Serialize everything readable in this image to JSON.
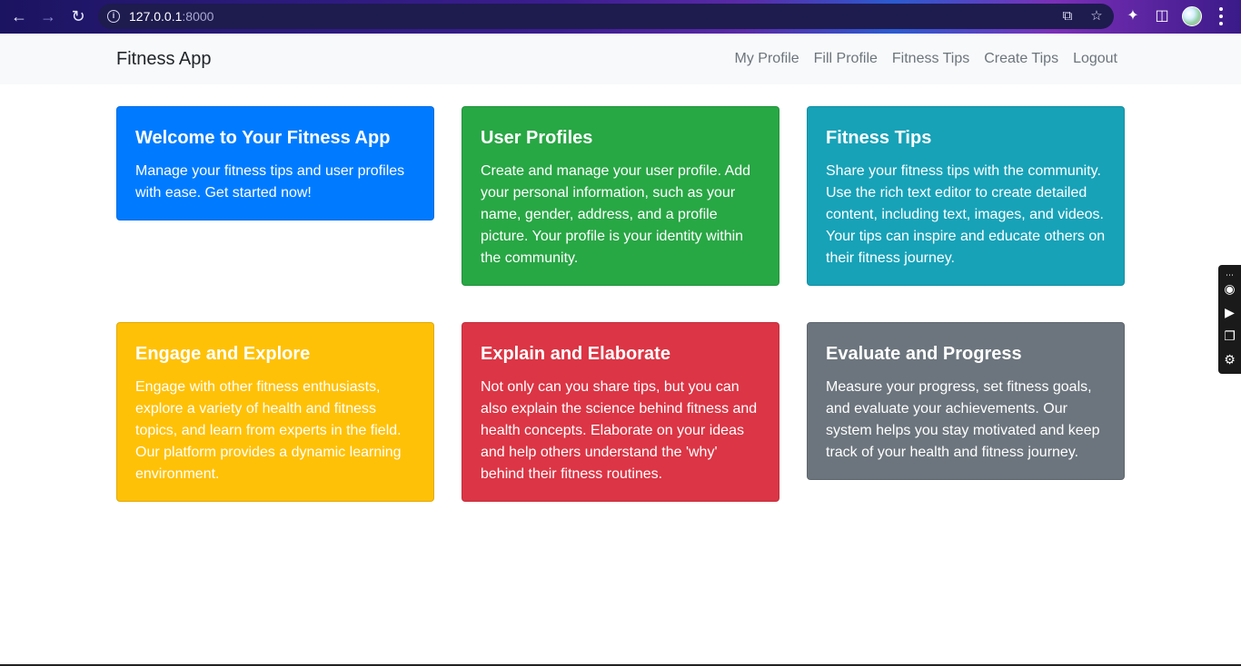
{
  "browser": {
    "url_host": "127.0.0.1",
    "url_port": ":8000"
  },
  "navbar": {
    "brand": "Fitness App",
    "links": [
      {
        "label": "My Profile"
      },
      {
        "label": "Fill Profile"
      },
      {
        "label": "Fitness Tips"
      },
      {
        "label": "Create Tips"
      },
      {
        "label": "Logout"
      }
    ]
  },
  "cards": [
    {
      "title": "Welcome to Your Fitness App",
      "text": "Manage your fitness tips and user profiles with ease. Get started now!",
      "color": "#007bff"
    },
    {
      "title": "User Profiles",
      "text": "Create and manage your user profile. Add your personal information, such as your name, gender, address, and a profile picture. Your profile is your identity within the community.",
      "color": "#28a745"
    },
    {
      "title": "Fitness Tips",
      "text": "Share your fitness tips with the community. Use the rich text editor to create detailed content, including text, images, and videos. Your tips can inspire and educate others on their fitness journey.",
      "color": "#17a2b8"
    },
    {
      "title": "Engage and Explore",
      "text": "Engage with other fitness enthusiasts, explore a variety of health and fitness topics, and learn from experts in the field. Our platform provides a dynamic learning environment.",
      "color": "#ffc107"
    },
    {
      "title": "Explain and Elaborate",
      "text": "Not only can you share tips, but you can also explain the science behind fitness and health concepts. Elaborate on your ideas and help others understand the 'why' behind their fitness routines.",
      "color": "#dc3545"
    },
    {
      "title": "Evaluate and Progress",
      "text": "Measure your progress, set fitness goals, and evaluate your achievements. Our system helps you stay motivated and keep track of your health and fitness journey.",
      "color": "#6c757d"
    }
  ],
  "icons": {
    "back": "back-arrow-icon",
    "forward": "forward-arrow-icon",
    "reload": "reload-icon",
    "info": "site-info-icon",
    "share": "share-icon",
    "bookmark": "star-icon",
    "extensions": "puzzle-icon",
    "sidepanel": "side-panel-icon",
    "menu": "kebab-menu-icon",
    "camera": "camera-icon",
    "video": "video-icon",
    "window": "window-icon",
    "settings": "gear-icon"
  }
}
